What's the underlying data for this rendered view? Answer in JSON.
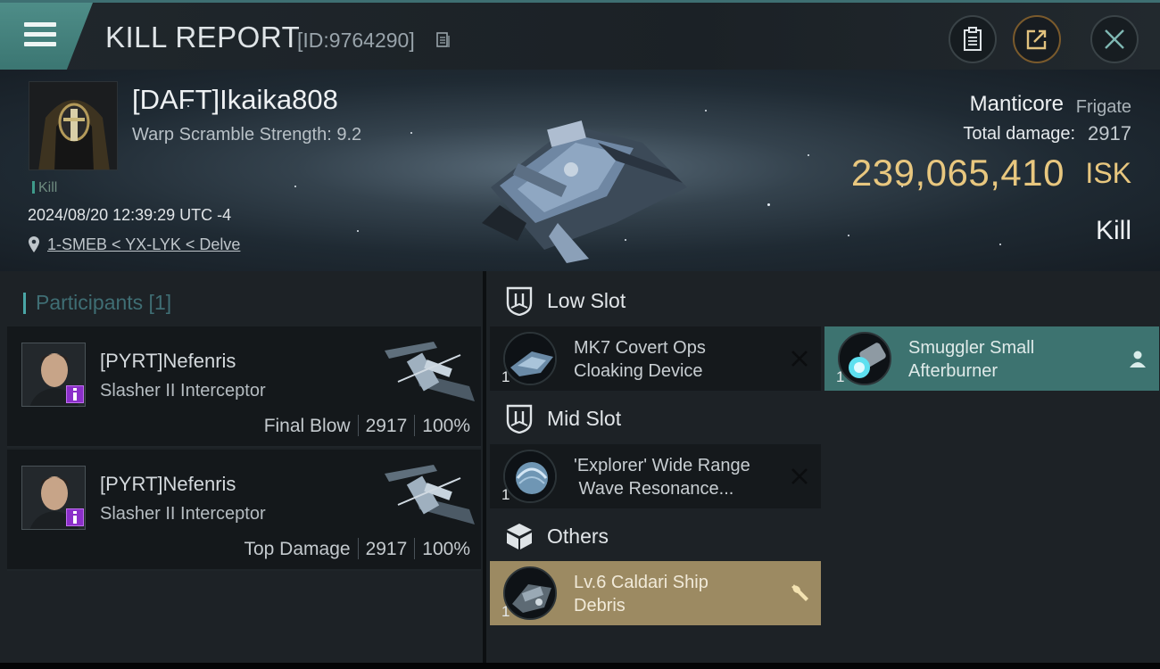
{
  "header": {
    "title": "KILL REPORT",
    "report_id": "[ID:9764290]"
  },
  "victim": {
    "name": "[DAFT]Ikaika808",
    "warp_scramble": "Warp Scramble Strength: 9.2",
    "tag": "Kill",
    "datetime": "2024/08/20 12:39:29 UTC -4",
    "location": "1-SMEB < YX-LYK < Delve",
    "ship_name": "Manticore",
    "ship_class": "Frigate",
    "total_damage_label": "Total damage:",
    "total_damage": "2917",
    "isk_value": "239,065,410",
    "isk_unit": "ISK",
    "kill_type": "Kill"
  },
  "participants": {
    "title": "Participants [1]",
    "items": [
      {
        "name": "[PYRT]Nefenris",
        "ship": "Slasher II Interceptor",
        "role": "Final Blow",
        "damage": "2917",
        "percent": "100%"
      },
      {
        "name": "[PYRT]Nefenris",
        "ship": "Slasher II Interceptor",
        "role": "Top Damage",
        "damage": "2917",
        "percent": "100%"
      }
    ]
  },
  "slots": {
    "low": {
      "label": "Low Slot",
      "modules": [
        {
          "name_line1": "MK7 Covert Ops",
          "name_line2": "Cloaking Device",
          "qty": "1"
        },
        {
          "name_line1": "Smuggler Small",
          "name_line2": "Afterburner",
          "qty": "1"
        }
      ]
    },
    "mid": {
      "label": "Mid Slot",
      "modules": [
        {
          "name_line1": "'Explorer' Wide Range",
          "name_line2": " Wave Resonance...",
          "qty": "1"
        }
      ]
    },
    "others": {
      "label": "Others",
      "modules": [
        {
          "name_line1": "Lv.6 Caldari Ship",
          "name_line2": "Debris",
          "qty": "1"
        }
      ]
    }
  },
  "colors": {
    "accent_teal": "#3d7370",
    "isk_gold": "#e8c77f",
    "debris_gold": "#9c8a62",
    "badge_purple": "#8b2fc9"
  },
  "icons": [
    "menu-icon",
    "copy-icon",
    "clipboard-icon",
    "share-icon",
    "close-icon",
    "pin-icon",
    "shield-slot-icon",
    "cube-icon",
    "person-icon",
    "wrench-icon",
    "destroyed-x-icon"
  ]
}
